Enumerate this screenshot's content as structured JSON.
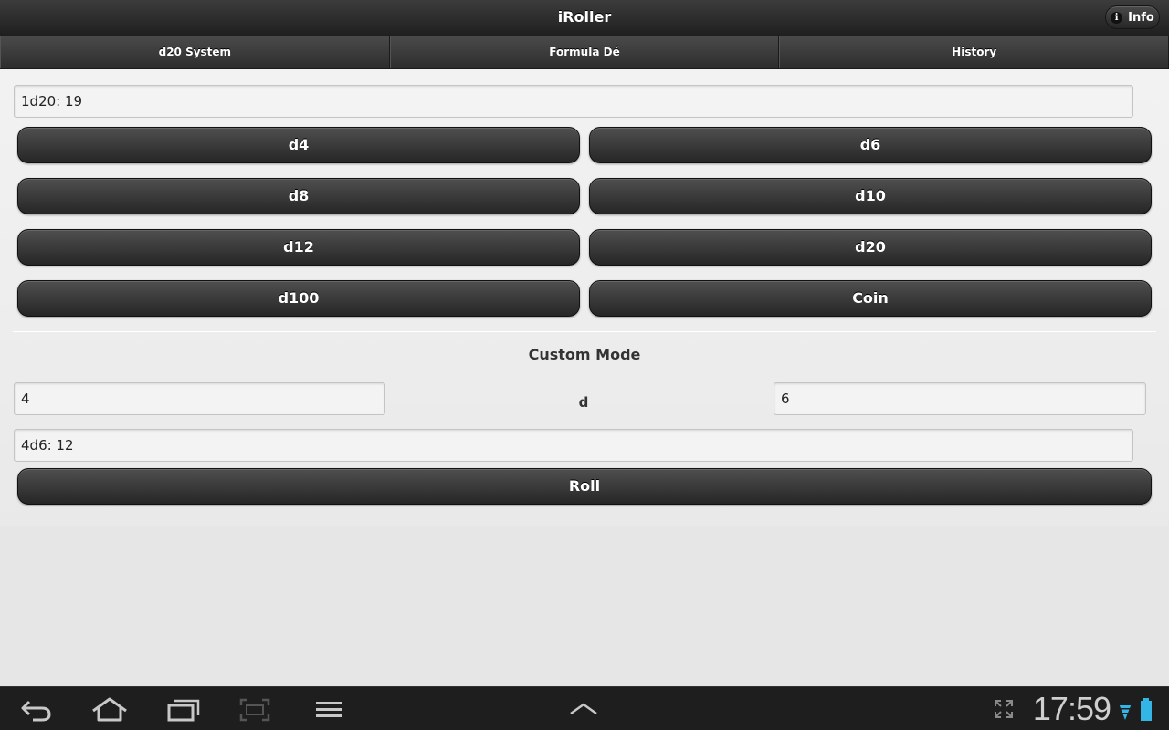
{
  "app": {
    "title": "iRoller",
    "info_label": "Info"
  },
  "tabs": [
    {
      "label": "d20 System"
    },
    {
      "label": "Formula Dé"
    },
    {
      "label": "History"
    }
  ],
  "d20": {
    "result": "1d20: 19",
    "buttons": [
      "d4",
      "d6",
      "d8",
      "d10",
      "d12",
      "d20",
      "d100",
      "Coin"
    ]
  },
  "custom": {
    "title": "Custom Mode",
    "count": "4",
    "separator": "d",
    "sides": "6",
    "result": "4d6: 12",
    "roll_label": "Roll"
  },
  "status": {
    "time": "17:59"
  },
  "icons": {
    "info": "info-icon",
    "back": "back-icon",
    "home": "home-icon",
    "recent": "recent-apps-icon",
    "screenshot": "screenshot-icon",
    "menu": "menu-icon",
    "up": "chevron-up-icon",
    "expand": "fullscreen-icon",
    "wifi": "wifi-icon",
    "battery": "battery-icon"
  },
  "colors": {
    "button": "#2e2e2e",
    "background": "#e6e6e6",
    "accent_blue": "#33b5e5"
  }
}
